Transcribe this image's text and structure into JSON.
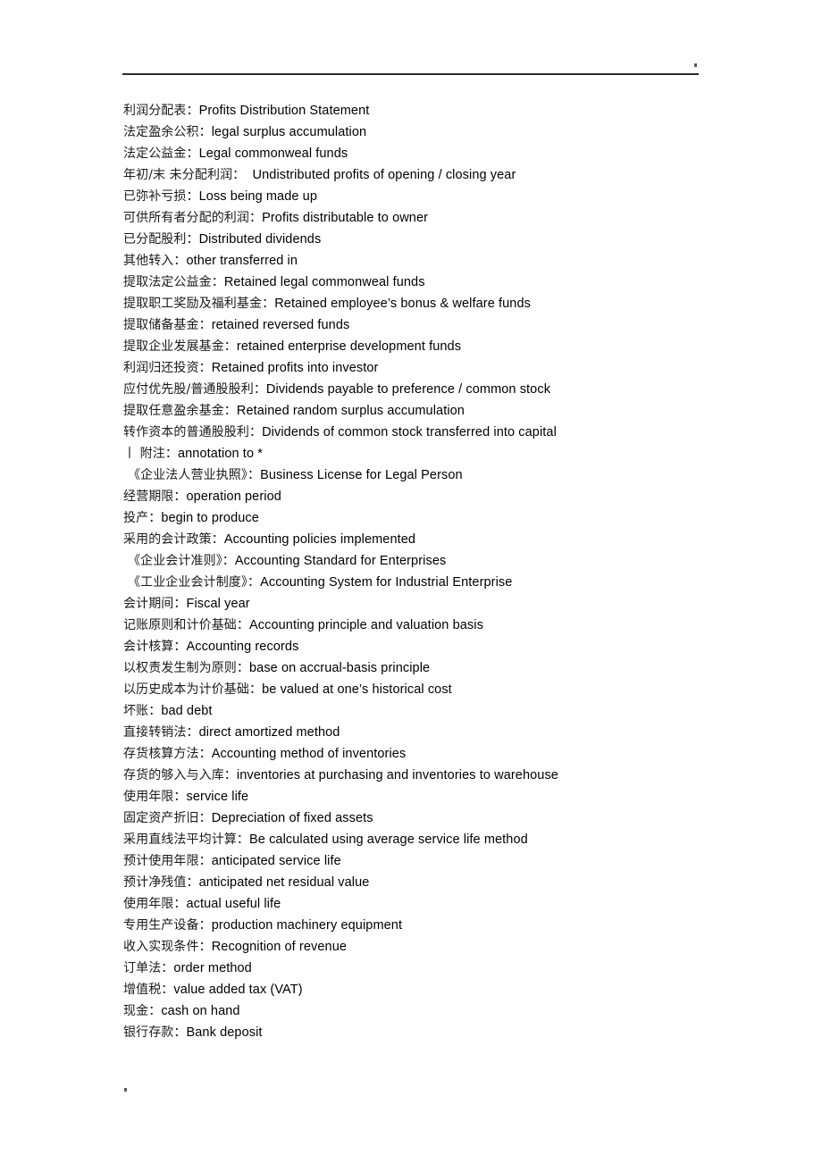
{
  "document": {
    "type": "bilingual-glossary",
    "header_rule": true,
    "header_mark": ".",
    "footer_mark": "."
  },
  "entries": [
    {
      "zh": "利润分配表：",
      "en": "Profits Distribution Statement",
      "bracket": false
    },
    {
      "zh": "法定盈余公积：",
      "en": "legal surplus accumulation",
      "bracket": false
    },
    {
      "zh": "法定公益金：",
      "en": "Legal commonweal funds",
      "bracket": false
    },
    {
      "zh": "年初/末 未分配利润：",
      "en": "  Undistributed profits of opening / closing year",
      "bracket": false
    },
    {
      "zh": "已弥补亏损：",
      "en": "Loss being made up",
      "bracket": false
    },
    {
      "zh": "可供所有者分配的利润：",
      "en": "Profits distributable to owner",
      "bracket": false
    },
    {
      "zh": "已分配股利：",
      "en": "Distributed dividends",
      "bracket": false
    },
    {
      "zh": "其他转入：",
      "en": "other transferred in",
      "bracket": false
    },
    {
      "zh": "提取法定公益金：",
      "en": "Retained legal commonweal funds",
      "bracket": false
    },
    {
      "zh": "提取职工奖励及福利基金：",
      "en": "Retained employee’s bonus & welfare funds",
      "bracket": false
    },
    {
      "zh": "提取储备基金：",
      "en": "retained reversed funds",
      "bracket": false
    },
    {
      "zh": "提取企业发展基金：",
      "en": "retained enterprise development funds",
      "bracket": false
    },
    {
      "zh": "利润归还投资：",
      "en": "Retained profits into investor",
      "bracket": false
    },
    {
      "zh": "应付优先股/普通股股利：",
      "en": "Dividends payable to preference / common stock",
      "bracket": false
    },
    {
      "zh": "提取任意盈余基金：",
      "en": "Retained random surplus accumulation",
      "bracket": false
    },
    {
      "zh": "转作资本的普通股股利：",
      "en": "Dividends of common stock transferred into capital",
      "bracket": false
    },
    {
      "zh": "丨 附注：",
      "en": "annotation to *",
      "bracket": false
    },
    {
      "zh": "《企业法人营业执照》：",
      "en": "Business License for Legal Person",
      "bracket": true
    },
    {
      "zh": "经营期限：",
      "en": "operation period",
      "bracket": false
    },
    {
      "zh": "投产：",
      "en": "begin to produce",
      "bracket": false
    },
    {
      "zh": "采用的会计政策：",
      "en": "Accounting policies implemented",
      "bracket": false
    },
    {
      "zh": "《企业会计准则》：",
      "en": "Accounting Standard for Enterprises",
      "bracket": true
    },
    {
      "zh": "《工业企业会计制度》：",
      "en": "Accounting System for Industrial Enterprise",
      "bracket": true
    },
    {
      "zh": "会计期间：",
      "en": "Fiscal year",
      "bracket": false
    },
    {
      "zh": "记账原则和计价基础：",
      "en": "Accounting principle and valuation basis",
      "bracket": false
    },
    {
      "zh": "会计核算：",
      "en": "Accounting records",
      "bracket": false
    },
    {
      "zh": "以权责发生制为原则：",
      "en": "base on accrual-basis principle",
      "bracket": false
    },
    {
      "zh": "以历史成本为计价基础：",
      "en": "be valued at one’s historical cost",
      "bracket": false
    },
    {
      "zh": "坏账：",
      "en": "bad debt",
      "bracket": false
    },
    {
      "zh": "直接转销法：",
      "en": "direct amortized method",
      "bracket": false
    },
    {
      "zh": "存货核算方法：",
      "en": "Accounting method of inventories",
      "bracket": false
    },
    {
      "zh": "存货的够入与入库：",
      "en": "inventories at purchasing and inventories to warehouse",
      "bracket": false
    },
    {
      "zh": "使用年限：",
      "en": "service life",
      "bracket": false
    },
    {
      "zh": "固定资产折旧：",
      "en": "Depreciation of fixed assets",
      "bracket": false
    },
    {
      "zh": "采用直线法平均计算：",
      "en": "Be calculated using average service life method",
      "bracket": false
    },
    {
      "zh": "预计使用年限：",
      "en": "anticipated service life",
      "bracket": false
    },
    {
      "zh": "预计净残值：",
      "en": "anticipated net residual value",
      "bracket": false
    },
    {
      "zh": "使用年限：",
      "en": "actual useful life",
      "bracket": false
    },
    {
      "zh": "专用生产设备：",
      "en": "production machinery equipment",
      "bracket": false
    },
    {
      "zh": "收入实现条件：",
      "en": "Recognition of revenue",
      "bracket": false
    },
    {
      "zh": "订单法：",
      "en": "order method",
      "bracket": false
    },
    {
      "zh": "增值税：",
      "en": "value added tax (VAT)",
      "bracket": false
    },
    {
      "zh": "现金：",
      "en": "cash on hand",
      "bracket": false
    },
    {
      "zh": "银行存款：",
      "en": "Bank deposit",
      "bracket": false
    }
  ]
}
